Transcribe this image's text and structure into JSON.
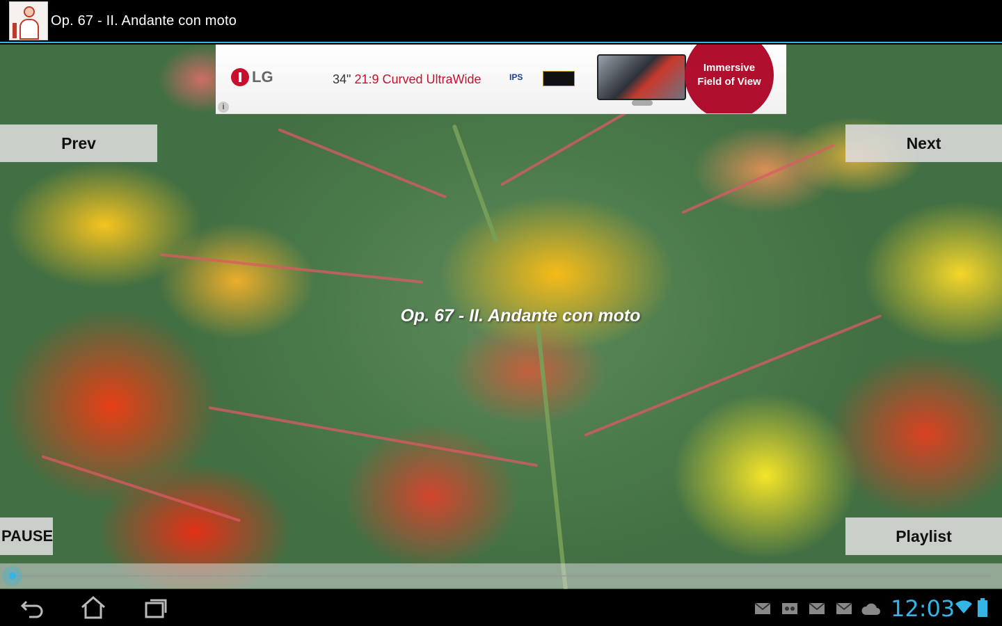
{
  "action_bar": {
    "title": "Op. 67 - II. Andante con moto"
  },
  "ad": {
    "brand": "LG",
    "headline_prefix": "34\"",
    "headline": "21:9 Curved UltraWide",
    "ips_label": "IPS",
    "circle_line1": "Immersive",
    "circle_line2": "Field of View",
    "info_icon": "i"
  },
  "controls": {
    "prev_label": "Prev",
    "next_label": "Next",
    "pause_label": "PAUSE",
    "playlist_label": "Playlist"
  },
  "player": {
    "now_playing": "Op. 67 - II. Andante con moto",
    "progress": 0.0
  },
  "system_bar": {
    "time": "12:03",
    "accent_color": "#33b5e5",
    "nav_icons": [
      "back-icon",
      "home-icon",
      "recent-apps-icon"
    ],
    "notification_icons": [
      "mail-icon",
      "voicemail-icon",
      "mail-icon",
      "mail-icon",
      "cloud-icon"
    ],
    "status_icons": [
      "wifi-icon",
      "battery-icon"
    ]
  }
}
